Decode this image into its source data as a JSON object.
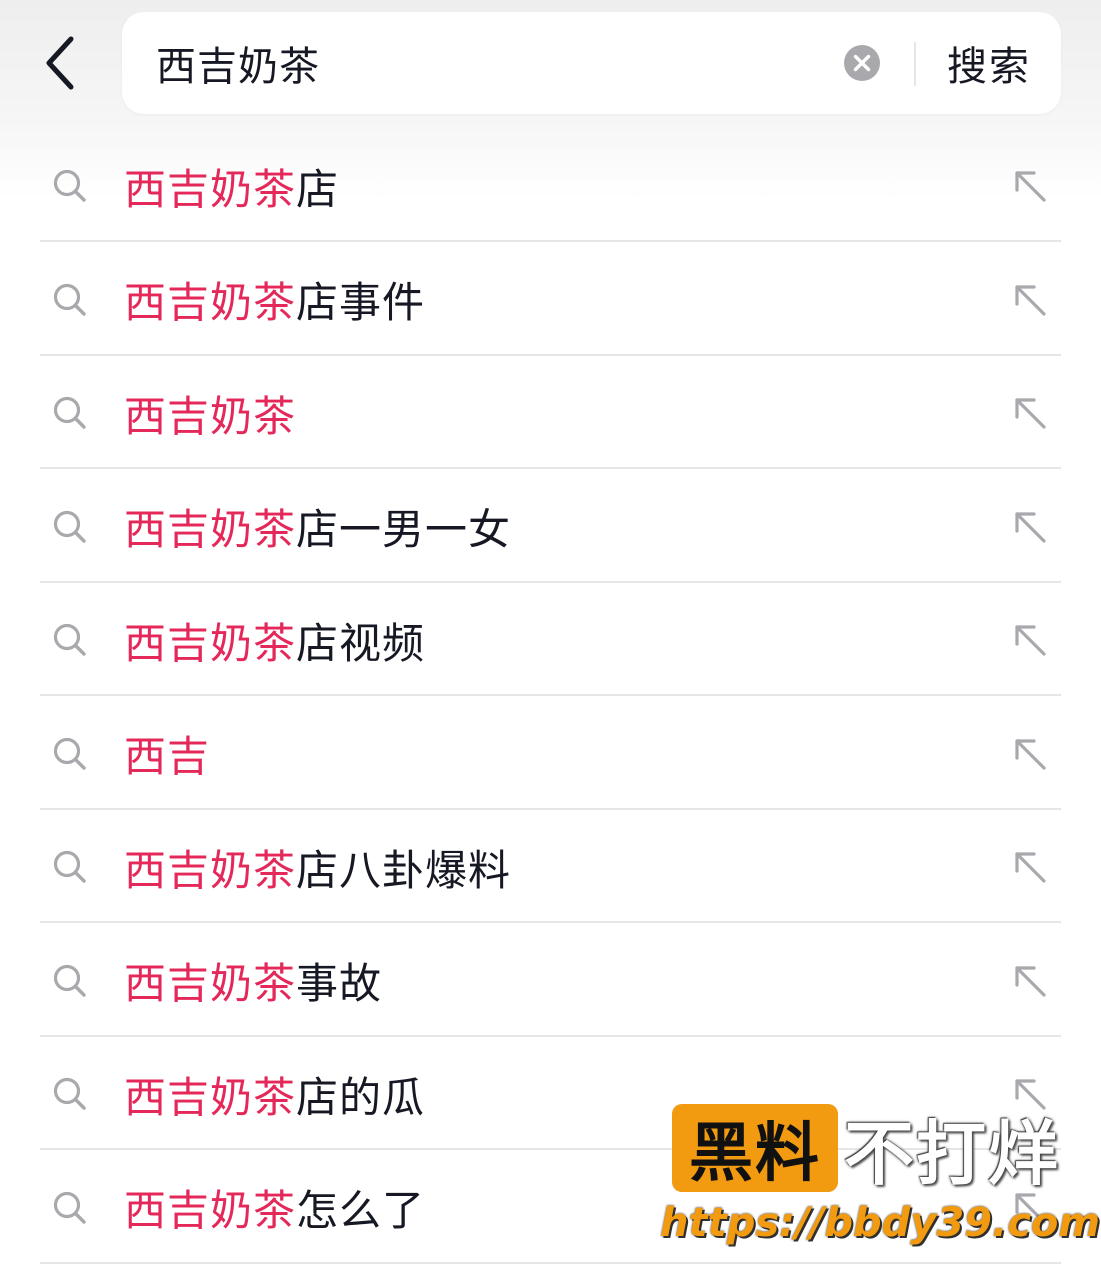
{
  "header": {
    "back_icon": "chevron-left-icon",
    "search_value": "西吉奶茶",
    "clear_icon": "clear-circle-icon",
    "search_button_label": "搜索"
  },
  "colors": {
    "highlight": "#e5285a",
    "text": "#161823",
    "icon": "#a8a8ad",
    "separator": "#e6e6e8",
    "watermark_orange": "#f29a10"
  },
  "suggestions": [
    {
      "highlight": "西吉奶茶",
      "rest": "店"
    },
    {
      "highlight": "西吉奶茶",
      "rest": "店事件"
    },
    {
      "highlight": "西吉奶茶",
      "rest": ""
    },
    {
      "highlight": "西吉奶茶",
      "rest": "店一男一女"
    },
    {
      "highlight": "西吉奶茶",
      "rest": "店视频"
    },
    {
      "highlight": "西吉",
      "rest": ""
    },
    {
      "highlight": "西吉奶茶",
      "rest": "店八卦爆料"
    },
    {
      "highlight": "西吉奶茶",
      "rest": "事故"
    },
    {
      "highlight": "西吉奶茶",
      "rest": "店的瓜"
    },
    {
      "highlight": "西吉奶茶",
      "rest": "怎么了"
    }
  ],
  "suggestion_icons": {
    "leading": "search-icon",
    "trailing": "arrow-up-left-icon"
  },
  "watermark": {
    "badge": "黑料",
    "text": "不打烊",
    "url": "https://bbdy39.com"
  }
}
